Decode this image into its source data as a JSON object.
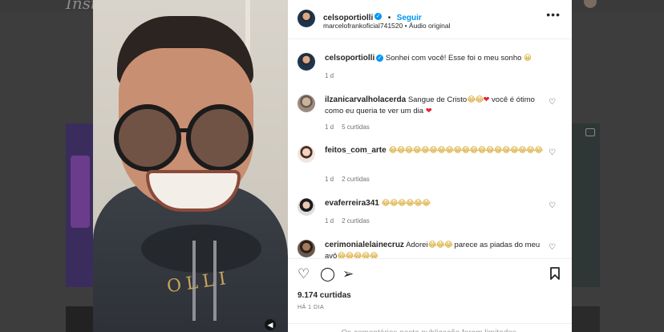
{
  "background": {
    "logo_text": "Insta"
  },
  "post": {
    "author": "celsoportiolli",
    "follow_label": "Seguir",
    "audio": "marcelofrankoficial741520 • Áudio original",
    "more_label": "•••",
    "hoodie_text": "OLLI"
  },
  "comments": [
    {
      "user": "celsoportiolli",
      "text": "Sonhei com você! Esse foi o meu sonho",
      "emoji": "😀",
      "time": "1 d",
      "likes": ""
    },
    {
      "user": "ilzanicarvalholacerda",
      "text": "Sangue de Cristo",
      "emoji": "😂😂",
      "heart": "❤",
      "text2": "você é ótimo como eu queria te ver um dia",
      "time": "1 d",
      "likes": "5 curtidas"
    },
    {
      "user": "feitos_com_arte",
      "emoji": "😂😂😂😂😂😂😂😂😂😂😂😂😂😂😂😂😂😂😂",
      "time": "1 d",
      "likes": "2 curtidas"
    },
    {
      "user": "evaferreira341",
      "emoji": "😂😂😂😂😂😂",
      "time": "1 d",
      "likes": "2 curtidas"
    },
    {
      "user": "cerimonialelainecruz",
      "text": "Adorei",
      "emoji": "😂😂😂",
      "text2": "parece as piadas do meu avô",
      "emoji2": "😂😂😂😂😂",
      "time": "",
      "likes": ""
    }
  ],
  "actions": {
    "likes_count": "9.174 curtidas",
    "posted": "HÁ 1 DIA",
    "comments_disabled": "Os comentários nesta publicação foram limitados."
  },
  "icons": [
    "heart-icon",
    "comment-icon",
    "share-icon",
    "bookmark-icon",
    "verified-icon",
    "more-icon",
    "sound-icon"
  ]
}
